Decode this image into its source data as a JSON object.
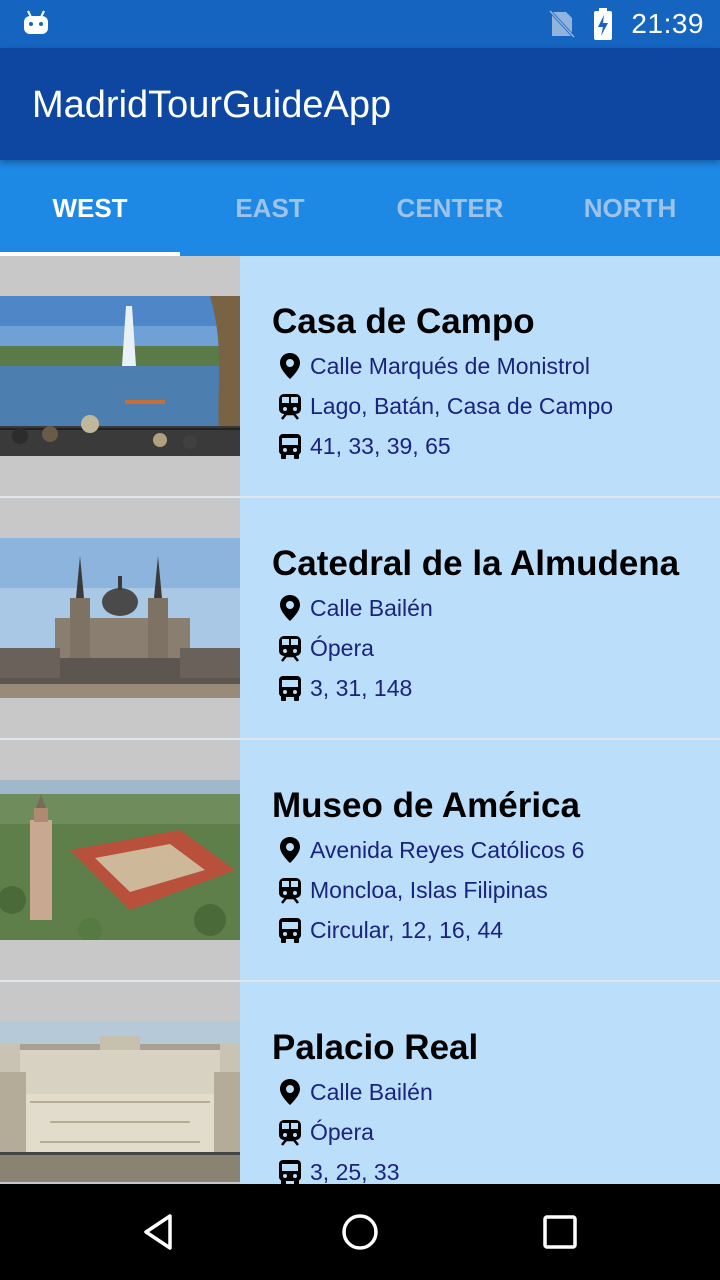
{
  "status_bar": {
    "time": "21:39"
  },
  "app": {
    "title": "MadridTourGuideApp"
  },
  "tabs": [
    {
      "label": "WEST"
    },
    {
      "label": "EAST"
    },
    {
      "label": "CENTER"
    },
    {
      "label": "NORTH"
    }
  ],
  "places": [
    {
      "name": "Casa de Campo",
      "address": "Calle Marqués de Monistrol",
      "metro": "Lago, Batán, Casa de Campo",
      "bus": "41, 33, 39, 65"
    },
    {
      "name": "Catedral de la Almudena",
      "address": "Calle Bailén",
      "metro": "Ópera",
      "bus": "3, 31, 148"
    },
    {
      "name": "Museo de América",
      "address": "Avenida Reyes Católicos 6",
      "metro": "Moncloa, Islas Filipinas",
      "bus": "Circular, 12, 16, 44"
    },
    {
      "name": "Palacio Real",
      "address": "Calle Bailén",
      "metro": "Ópera",
      "bus": "3, 25, 33"
    }
  ],
  "colors": {
    "status_bar": "#1565c0",
    "app_bar": "#0d47a1",
    "tab_bar": "#1e88e5",
    "list_background": "#bbdefb",
    "detail_text": "#1a237e"
  },
  "icons": [
    "android-icon",
    "no-sim-icon",
    "battery-charging-icon",
    "location-pin-icon",
    "metro-icon",
    "bus-icon",
    "back-icon",
    "home-icon",
    "recents-icon"
  ]
}
